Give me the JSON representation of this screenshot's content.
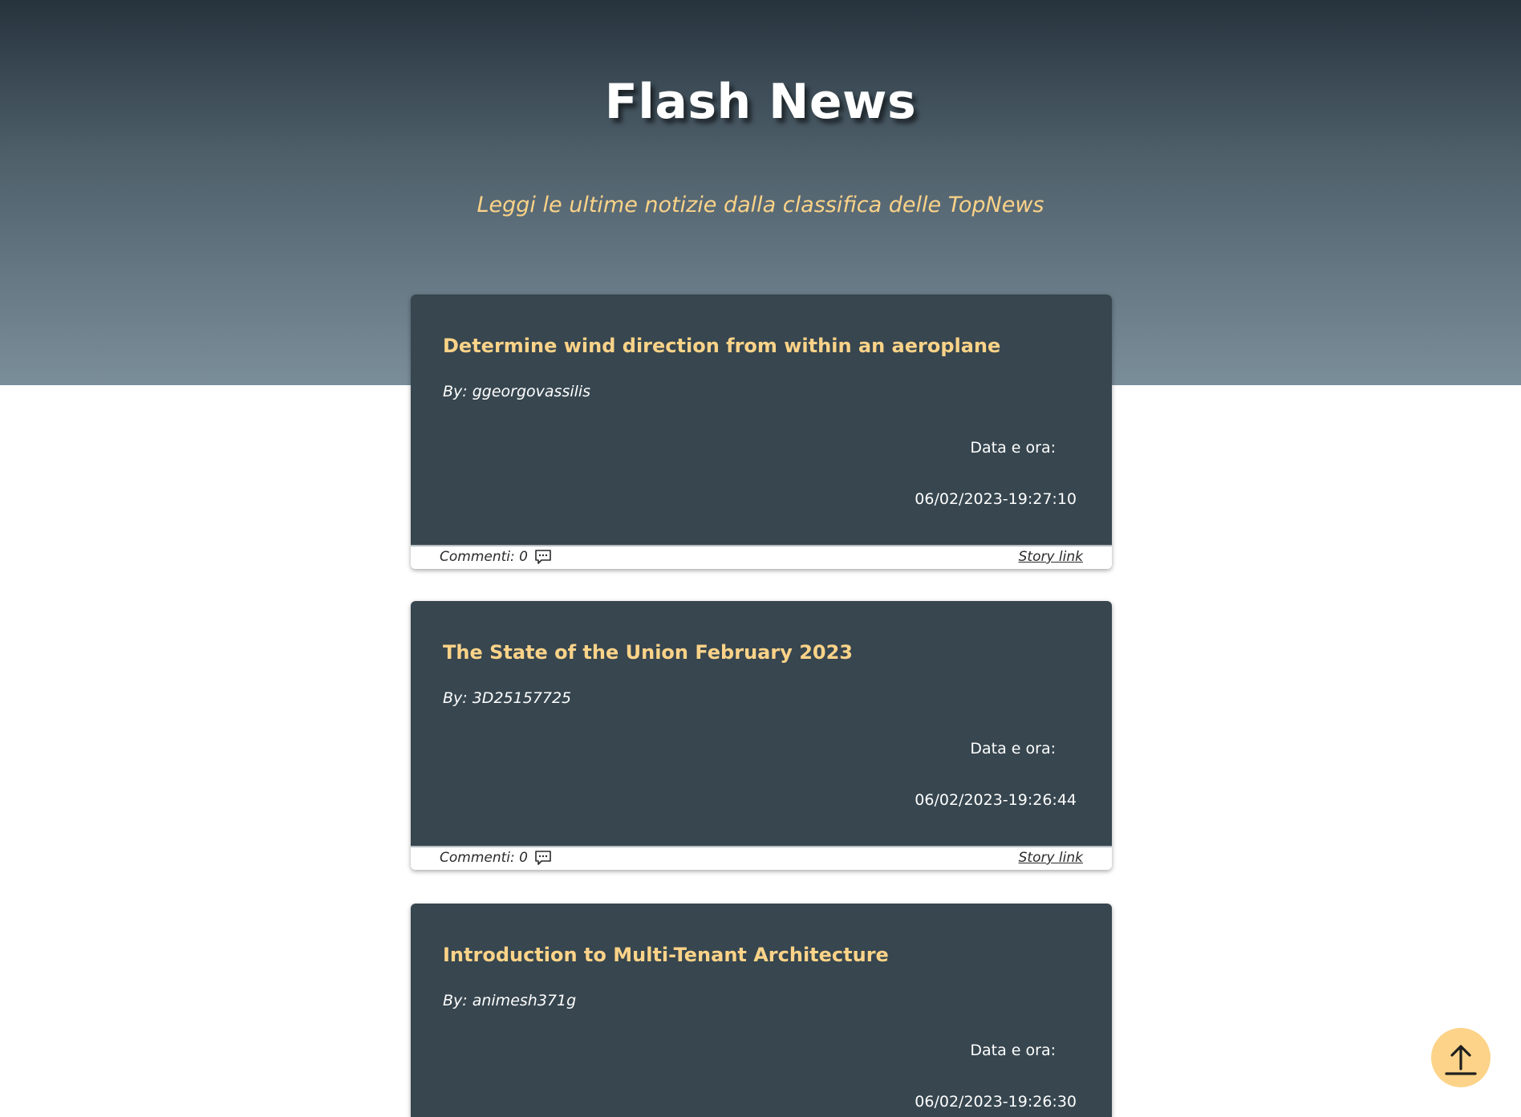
{
  "header": {
    "title": "Flash News",
    "subtitle": "Leggi le ultime notizie dalla classifica delle TopNews"
  },
  "colors": {
    "accent": "#fcd388",
    "card_bg": "#37464f",
    "hero_top": "#26333d",
    "hero_bottom": "#7a8e9a"
  },
  "stories": [
    {
      "title": "Determine wind direction from within an aeroplane",
      "author": "By: ggeorgovassilis",
      "date_label": "Data e ora:",
      "date": "06/02/2023-19:27:10",
      "comments": "Commenti: 0",
      "comment_icon": "comment-icon",
      "link_label": "Story link"
    },
    {
      "title": "The State of the Union February 2023",
      "author": "By: 3D25157725",
      "date_label": "Data e ora:",
      "date": "06/02/2023-19:26:44",
      "comments": "Commenti: 0",
      "comment_icon": "comment-icon",
      "link_label": "Story link"
    },
    {
      "title": "Introduction to Multi-Tenant Architecture",
      "author": "By: animesh371g",
      "date_label": "Data e ora:",
      "date": "06/02/2023-19:26:30",
      "comments": "",
      "comment_icon": "comment-icon",
      "link_label": ""
    }
  ],
  "scroll_top_icon": "arrow-up-icon"
}
